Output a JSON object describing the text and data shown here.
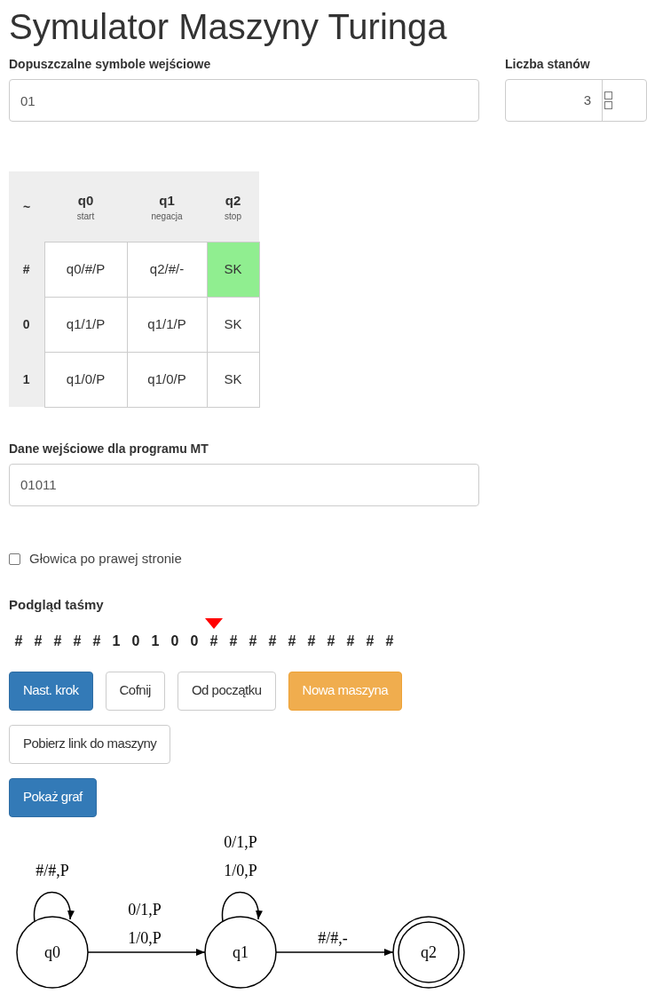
{
  "title": "Symulator Maszyny Turinga",
  "symbols_field": {
    "label": "Dopuszczalne symbole wejściowe",
    "value": "01"
  },
  "states_field": {
    "label": "Liczba stanów",
    "value": "3"
  },
  "table": {
    "corner": "~",
    "columns": [
      {
        "name": "q0",
        "note": "start"
      },
      {
        "name": "q1",
        "note": "negacja"
      },
      {
        "name": "q2",
        "note": "stop"
      }
    ],
    "rows": [
      {
        "symbol": "#",
        "cells": [
          {
            "text": "q0/#/P",
            "selected": false
          },
          {
            "text": "q2/#/-",
            "selected": false
          },
          {
            "text": "SK",
            "selected": true
          }
        ]
      },
      {
        "symbol": "0",
        "cells": [
          {
            "text": "q1/1/P",
            "selected": false
          },
          {
            "text": "q1/1/P",
            "selected": false
          },
          {
            "text": "SK",
            "selected": false
          }
        ]
      },
      {
        "symbol": "1",
        "cells": [
          {
            "text": "q1/0/P",
            "selected": false
          },
          {
            "text": "q1/0/P",
            "selected": false
          },
          {
            "text": "SK",
            "selected": false
          }
        ]
      }
    ]
  },
  "input_field": {
    "label": "Dane wejściowe dla programu MT",
    "value": "01011"
  },
  "head_right": {
    "label": "Głowica po prawej stronie",
    "checked": false
  },
  "tape": {
    "label": "Podgląd taśmy",
    "cells": [
      {
        "symbol": "#",
        "head": false
      },
      {
        "symbol": "#",
        "head": false
      },
      {
        "symbol": "#",
        "head": false
      },
      {
        "symbol": "#",
        "head": false
      },
      {
        "symbol": "#",
        "head": false
      },
      {
        "symbol": "1",
        "head": false
      },
      {
        "symbol": "0",
        "head": false
      },
      {
        "symbol": "1",
        "head": false
      },
      {
        "symbol": "0",
        "head": false
      },
      {
        "symbol": "0",
        "head": false
      },
      {
        "symbol": "#",
        "head": true
      },
      {
        "symbol": "#",
        "head": false
      },
      {
        "symbol": "#",
        "head": false
      },
      {
        "symbol": "#",
        "head": false
      },
      {
        "symbol": "#",
        "head": false
      },
      {
        "symbol": "#",
        "head": false
      },
      {
        "symbol": "#",
        "head": false
      },
      {
        "symbol": "#",
        "head": false
      },
      {
        "symbol": "#",
        "head": false
      },
      {
        "symbol": "#",
        "head": false
      }
    ]
  },
  "buttons": [
    {
      "label": "Nast. krok",
      "kind": "primary"
    },
    {
      "label": "Cofnij",
      "kind": "default"
    },
    {
      "label": "Od początku",
      "kind": "default"
    },
    {
      "label": "Nowa maszyna",
      "kind": "warning"
    },
    {
      "label": "Pobierz link do maszyny",
      "kind": "default"
    },
    {
      "label": "Pokaż graf",
      "kind": "primary"
    }
  ],
  "graph": {
    "nodes": [
      {
        "label": "q0",
        "accepting": false,
        "loop_labels": [
          "#/#,P"
        ],
        "next_labels": [
          "0/1,P",
          "1/0,P"
        ]
      },
      {
        "label": "q1",
        "accepting": false,
        "loop_labels": [
          "0/1,P",
          "1/0,P"
        ],
        "next_labels": [
          "#/#,-"
        ]
      },
      {
        "label": "q2",
        "accepting": true
      }
    ]
  }
}
